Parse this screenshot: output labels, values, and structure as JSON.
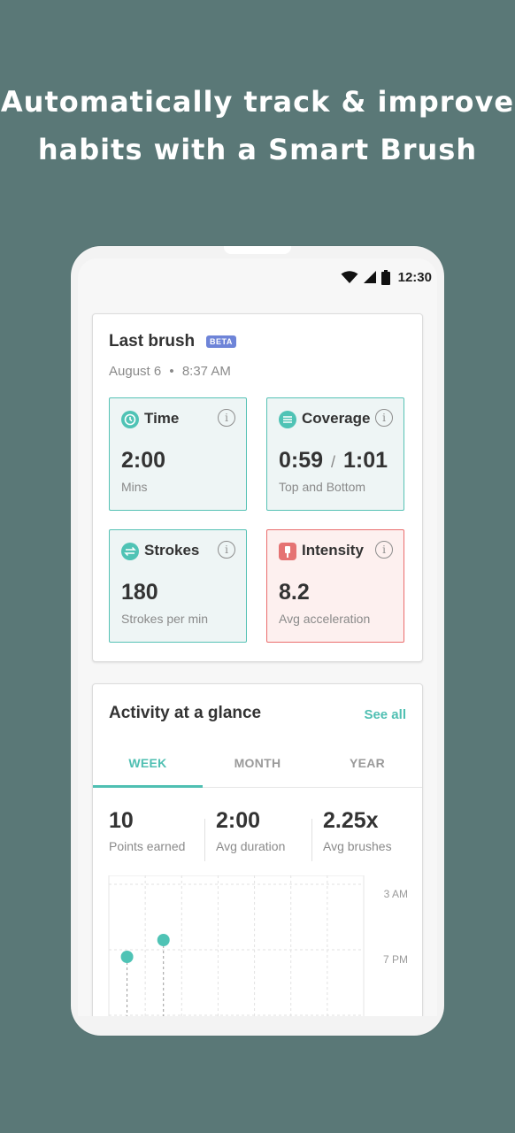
{
  "headline": {
    "line1": "Automatically track & improve",
    "line2": "habits with a Smart Brush"
  },
  "status_bar": {
    "time": "12:30",
    "icons": [
      "wifi-icon",
      "cellular-icon",
      "battery-icon"
    ]
  },
  "last_brush": {
    "title": "Last brush",
    "badge": "BETA",
    "date": "August 6",
    "separator": "•",
    "time": "8:37 AM",
    "tiles": {
      "time": {
        "title": "Time",
        "value": "2:00",
        "sub": "Mins",
        "icon": "clock-icon"
      },
      "coverage": {
        "title": "Coverage",
        "value": "0:59",
        "value2": "1:01",
        "divider": "/",
        "sub": "Top and Bottom",
        "icon": "coverage-icon"
      },
      "strokes": {
        "title": "Strokes",
        "value": "180",
        "sub": "Strokes per min",
        "icon": "strokes-icon"
      },
      "intensity": {
        "title": "Intensity",
        "value": "8.2",
        "sub": "Avg acceleration",
        "icon": "brush-icon"
      }
    },
    "info_glyph": "i"
  },
  "activity": {
    "title": "Activity at a glance",
    "see_all": "See all",
    "tabs": [
      "WEEK",
      "MONTH",
      "YEAR"
    ],
    "active_tab": "WEEK",
    "stats": [
      {
        "value": "10",
        "label": "Points earned"
      },
      {
        "value": "2:00",
        "label": "Avg duration"
      },
      {
        "value": "2.25x",
        "label": "Avg brushes"
      }
    ]
  },
  "chart_data": {
    "type": "scatter",
    "title": "",
    "xlabel": "",
    "ylabel": "",
    "y_tick_labels": [
      "3 AM",
      "7 PM"
    ],
    "grid": true,
    "columns": 7,
    "points": [
      {
        "day_index": 0,
        "time": "~8 PM"
      },
      {
        "day_index": 1,
        "time": "~6:30 PM"
      }
    ],
    "point_color": "#4fc3b5"
  },
  "colors": {
    "background": "#5a7877",
    "accent": "#4fbfb2",
    "alert": "#ea6d6d",
    "beta_badge": "#6e84d8"
  }
}
